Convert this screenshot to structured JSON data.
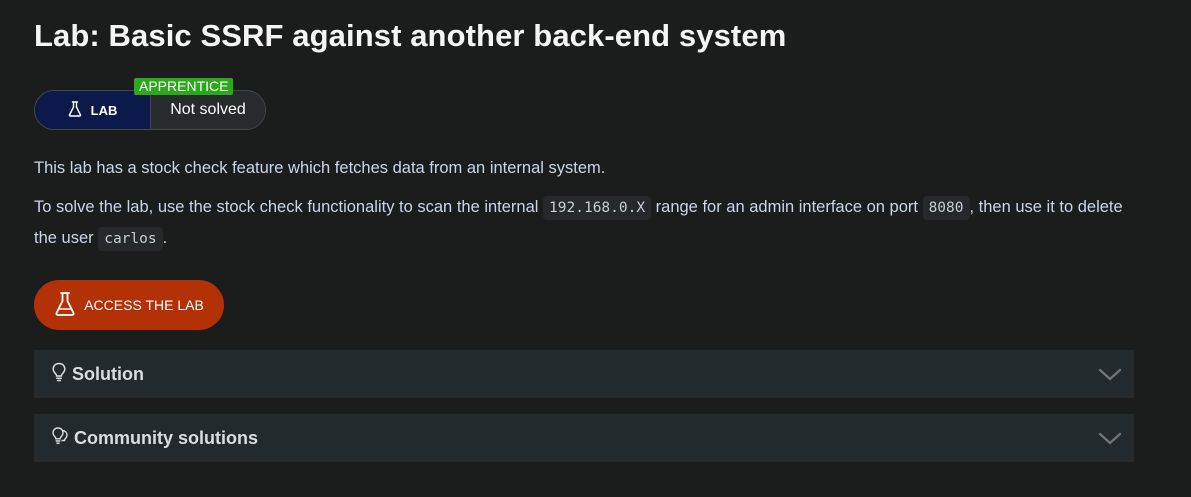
{
  "page": {
    "title": "Lab: Basic SSRF against another back-end system"
  },
  "badge": {
    "level": "APPRENTICE",
    "type_label": "LAB",
    "status": "Not solved",
    "level_color": "#2ba91b",
    "type_color": "#0b1a4a"
  },
  "description": {
    "line1": "This lab has a stock check feature which fetches data from an internal system.",
    "part1": "To solve the lab, use the stock check functionality to scan the internal ",
    "code1": "192.168.0.X",
    "part2": " range for an admin interface on port ",
    "code2": "8080",
    "part3": ", then use it to delete the user ",
    "code3": "carlos",
    "part4": "."
  },
  "access_button": {
    "label": "ACCESS THE LAB",
    "icon": "flask-icon",
    "color": "#b33107"
  },
  "accordions": [
    {
      "label": "Solution",
      "icon": "lightbulb-icon"
    },
    {
      "label": "Community solutions",
      "icon": "lightbulbs-icon"
    }
  ]
}
